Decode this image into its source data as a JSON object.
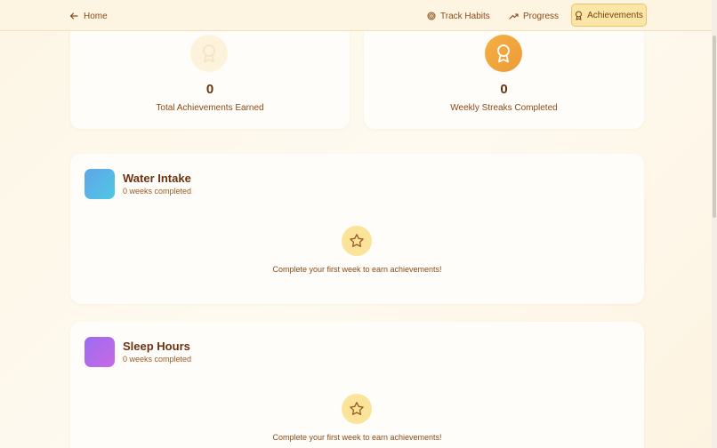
{
  "nav": {
    "home_label": "Home",
    "track_label": "Track Habits",
    "progress_label": "Progress",
    "achievements_label": "Achievements"
  },
  "stats": [
    {
      "value": "0",
      "label": "Total Achievements Earned",
      "icon": "award-icon"
    },
    {
      "value": "0",
      "label": "Weekly Streaks Completed",
      "icon": "award-icon"
    }
  ],
  "habits": [
    {
      "name": "Water Intake",
      "subtitle": "0 weeks completed",
      "empty_text": "Complete your first week to earn achievements!",
      "tile_colors": [
        "#60a5e8",
        "#4fc7e3"
      ]
    },
    {
      "name": "Sleep Hours",
      "subtitle": "0 weeks completed",
      "empty_text": "Complete your first week to earn achievements!",
      "tile_colors": [
        "#9b6cf0",
        "#c76ae6"
      ]
    }
  ],
  "colors": {
    "accent": "#fae7a8",
    "accent_border": "#e9c468",
    "text_primary": "#6b3210",
    "award_orange": "#f0a23c"
  }
}
